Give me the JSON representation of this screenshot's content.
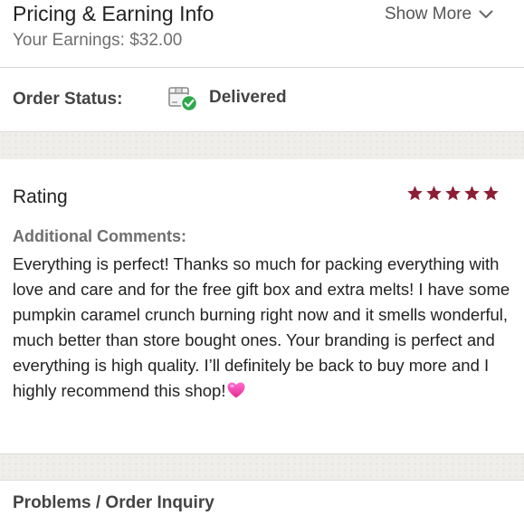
{
  "pricing": {
    "title": "Pricing & Earning Info",
    "earnings": "Your Earnings: $32.00",
    "show_more": "Show More",
    "show_more_icon": "chevron-down-icon"
  },
  "order_status": {
    "label": "Order Status:",
    "icon": "package-delivered-icon",
    "value": "Delivered",
    "status_color": "#2ea84a"
  },
  "rating": {
    "title": "Rating",
    "stars": 5,
    "max_stars": 5,
    "star_color": "#8b1f35",
    "comments_label": "Additional Comments:",
    "comments": "Everything is perfect! Thanks so much for packing everything with love and care and for the free gift box and extra melts! I have some pumpkin caramel crunch burning right now and it smells wonderful, much better than store bought ones. Your branding is perfect and everything is high quality. I’ll definitely be back to buy more and I highly recommend this shop!",
    "comments_emoji": "pink-heart-icon"
  },
  "problems": {
    "title": "Problems / Order Inquiry"
  }
}
